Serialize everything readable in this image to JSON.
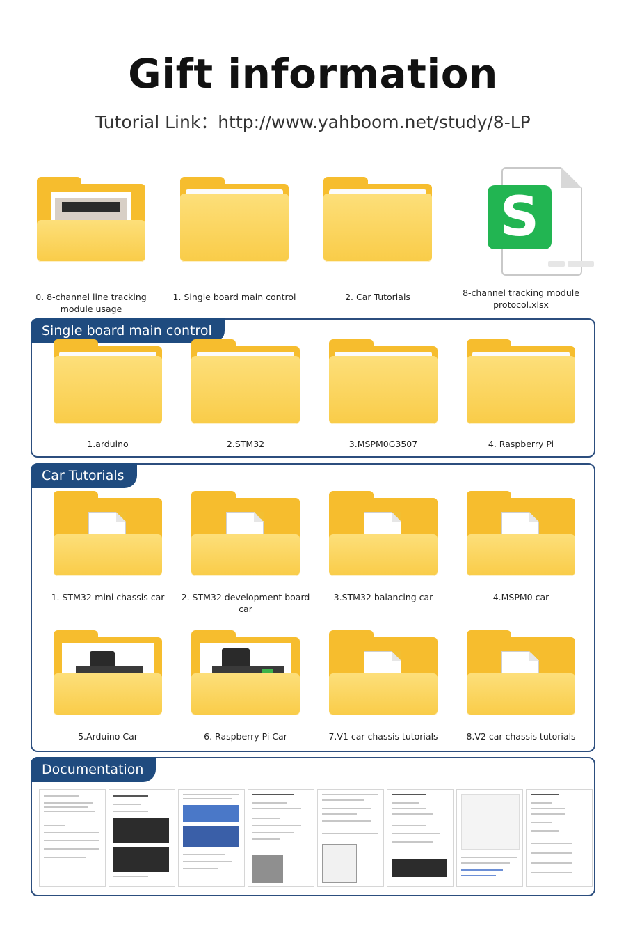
{
  "title": "Gift information",
  "subtitle": "Tutorial Link：http://www.yahboom.net/study/8-LP",
  "top_items": [
    {
      "label_line1": "0. 8-channel line tracking",
      "label_line2": "module usage",
      "icon": "folder-with-photo-icon"
    },
    {
      "label_line1": "1. Single board main control",
      "label_line2": "",
      "icon": "folder-icon"
    },
    {
      "label_line1": "2. Car Tutorials",
      "label_line2": "",
      "icon": "folder-icon"
    },
    {
      "label_line1": "8-channel tracking module",
      "label_line2": "protocol.xlsx",
      "icon": "spreadsheet-file-icon"
    }
  ],
  "single_board": {
    "tag": "Single board main control",
    "items": [
      "1.arduino",
      "2.STM32",
      "3.MSPM0G3507",
      "4. Raspberry Pi"
    ]
  },
  "car_tutorials": {
    "tag": "Car Tutorials",
    "row1": [
      {
        "line1": "1. STM32-mini chassis car",
        "line2": ""
      },
      {
        "line1": "2. STM32 development board",
        "line2": "car"
      },
      {
        "line1": "3.STM32 balancing car",
        "line2": ""
      },
      {
        "line1": "4.MSPM0 car",
        "line2": ""
      }
    ],
    "row2": [
      {
        "line1": "5.Arduino Car",
        "line2": ""
      },
      {
        "line1": "6. Raspberry Pi Car",
        "line2": ""
      },
      {
        "line1": "7.V1 car chassis tutorials",
        "line2": ""
      },
      {
        "line1": "8.V2 car chassis tutorials",
        "line2": ""
      }
    ]
  },
  "documentation": {
    "tag": "Documentation",
    "thumb_count": 8
  },
  "colors": {
    "accent": "#1f4b7f",
    "border": "#2c4e7e",
    "folder": "#f6bd2e",
    "spreadsheet_green": "#22b552"
  }
}
